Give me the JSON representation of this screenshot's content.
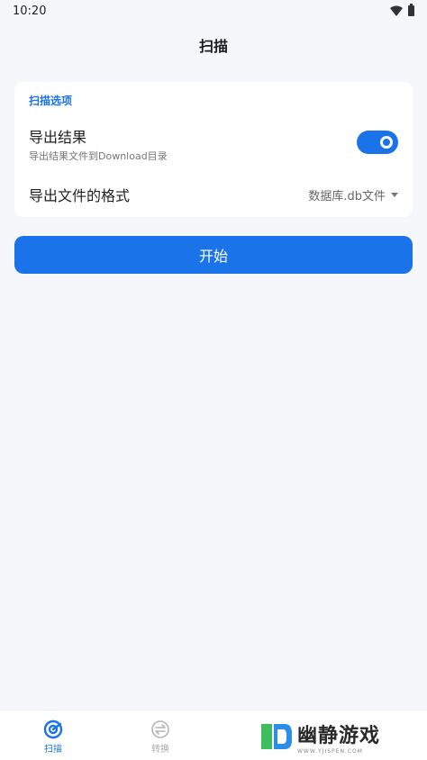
{
  "status_bar": {
    "time": "10:20"
  },
  "app_bar": {
    "title": "扫描"
  },
  "scan_options": {
    "section_label": "扫描选项",
    "export_result": {
      "title": "导出结果",
      "subtitle": "导出结果文件到Download目录",
      "enabled": true
    },
    "export_format": {
      "title": "导出文件的格式",
      "selected": "数据库.db文件"
    }
  },
  "start_button": {
    "label": "开始"
  },
  "bottom_nav": {
    "items": [
      {
        "label": "扫描",
        "icon": "scan-icon",
        "active": true
      },
      {
        "label": "转换",
        "icon": "convert-icon",
        "active": false
      }
    ]
  },
  "watermark": {
    "text": "幽静游戏",
    "url": "WWW.YJISPEN.COM"
  },
  "colors": {
    "accent": "#1a73e8",
    "background": "#f5f7fa",
    "card": "#ffffff"
  }
}
